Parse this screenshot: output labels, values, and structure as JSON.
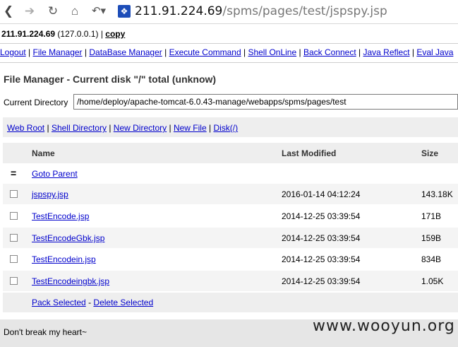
{
  "browser": {
    "url_host": "211.91.224.69",
    "url_path": "/spms/pages/test/jspspy.jsp",
    "icons": [
      "back-icon",
      "forward-icon",
      "reload-icon",
      "home-icon",
      "history-icon",
      "site-icon"
    ]
  },
  "host": {
    "ip": "211.91.224.69",
    "local": "(127.0.0.1)",
    "sep": "|",
    "copy_label": "copy"
  },
  "menu": [
    {
      "label": "Logout"
    },
    {
      "label": "File Manager"
    },
    {
      "label": "DataBase Manager"
    },
    {
      "label": "Execute Command"
    },
    {
      "label": "Shell OnLine"
    },
    {
      "label": "Back Connect"
    },
    {
      "label": "Java Reflect"
    },
    {
      "label": "Eval Java"
    }
  ],
  "file_manager": {
    "title": "File Manager - Current disk \"/\" total (unknow)",
    "current_directory_label": "Current Directory",
    "current_directory_value": "/home/deploy/apache-tomcat-6.0.43-manage/webapps/spms/pages/test"
  },
  "links": [
    {
      "label": "Web Root"
    },
    {
      "label": "Shell Directory"
    },
    {
      "label": "New Directory"
    },
    {
      "label": "New File"
    },
    {
      "label": "Disk(/)"
    }
  ],
  "table": {
    "headers": {
      "name": "Name",
      "modified": "Last Modified",
      "size": "Size"
    },
    "goto_parent": {
      "marker": "=",
      "label": "Goto Parent"
    },
    "rows": [
      {
        "name": "jspspy.jsp",
        "modified": "2016-01-14 04:12:24",
        "size": "143.18K"
      },
      {
        "name": "TestEncode.jsp",
        "modified": "2014-12-25 03:39:54",
        "size": "171B"
      },
      {
        "name": "TestEncodeGbk.jsp",
        "modified": "2014-12-25 03:39:54",
        "size": "159B"
      },
      {
        "name": "TestEncodein.jsp",
        "modified": "2014-12-25 03:39:54",
        "size": "834B"
      },
      {
        "name": "TestEncodeingbk.jsp",
        "modified": "2014-12-25 03:39:54",
        "size": "1.05K"
      }
    ]
  },
  "actions": {
    "pack": "Pack Selected",
    "dash": "-",
    "delete": "Delete Selected"
  },
  "footer": {
    "text": "Don't break my heart~",
    "watermark": "www.wooyun.org"
  }
}
